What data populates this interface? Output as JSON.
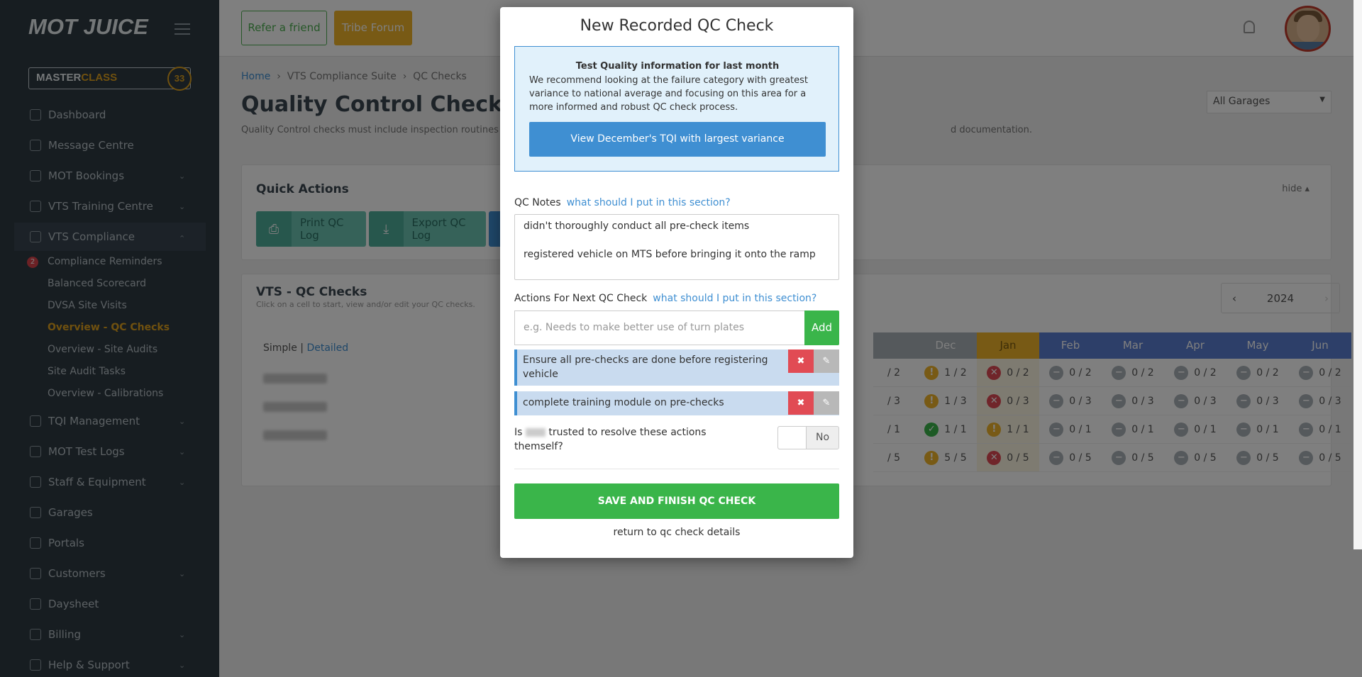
{
  "sidebar": {
    "logo": "MOT JUICE",
    "masterclass": {
      "part1": "MASTER",
      "part2": "CLASS",
      "badge": "33"
    },
    "items": [
      {
        "label": "Dashboard",
        "icon": "home-icon"
      },
      {
        "label": "Message Centre",
        "icon": "chat-icon"
      },
      {
        "label": "MOT Bookings",
        "icon": "bookings-icon"
      },
      {
        "label": "VTS Training Centre",
        "icon": "trophy-icon"
      },
      {
        "label": "VTS Compliance",
        "icon": "check-square-icon"
      },
      {
        "label": "TQI Management",
        "icon": "diamond-icon"
      },
      {
        "label": "MOT Test Logs",
        "icon": "id-card-icon"
      },
      {
        "label": "Staff & Equipment",
        "icon": "user-icon"
      },
      {
        "label": "Garages",
        "icon": "building-icon"
      },
      {
        "label": "Portals",
        "icon": "globe-icon"
      },
      {
        "label": "Customers",
        "icon": "users-icon"
      },
      {
        "label": "Daysheet",
        "icon": "document-icon"
      },
      {
        "label": "Billing",
        "icon": "wallet-icon"
      },
      {
        "label": "Help & Support",
        "icon": "help-icon"
      }
    ],
    "subitems": [
      "Compliance Reminders",
      "Balanced Scorecard",
      "DVSA Site Visits",
      "Overview - QC Checks",
      "Overview - Site Audits",
      "Site Audit Tasks",
      "Overview - Calibrations"
    ],
    "reminder_badge": "2"
  },
  "topbar": {
    "refer": "Refer a friend",
    "tribe": "Tribe Forum"
  },
  "main": {
    "breadcrumb": [
      "Home",
      "VTS Compliance Suite",
      "QC Checks"
    ],
    "title": "Quality Control Checks",
    "desc_start": "Quality Control checks must include inspection routines and",
    "desc_end": "d documentation.",
    "garage_select": "All Garages",
    "quick_actions": {
      "title": "Quick Actions",
      "hide": "hide",
      "print": "Print QC Log",
      "export": "Export QC Log"
    },
    "vts": {
      "title": "VTS - QC Checks",
      "subtitle": "Click on a cell to start, view and/or edit your QC checks.",
      "simple": "Simple",
      "detailed": "Detailed",
      "year": "2024"
    },
    "months": [
      "Dec",
      "Jan",
      "Feb",
      "Mar",
      "Apr",
      "May",
      "Jun"
    ],
    "prev_col": [
      "2",
      "3",
      "1",
      "5"
    ],
    "rows": [
      [
        "1 / 2",
        "0 / 2",
        "0 / 2",
        "0 / 2",
        "0 / 2",
        "0 / 2",
        "0 / 2"
      ],
      [
        "1 / 3",
        "0 / 3",
        "0 / 3",
        "0 / 3",
        "0 / 3",
        "0 / 3",
        "0 / 3"
      ],
      [
        "1 / 1",
        "1 / 1",
        "0 / 1",
        "0 / 1",
        "0 / 1",
        "0 / 1",
        "0 / 1"
      ],
      [
        "5 / 5",
        "0 / 5",
        "0 / 5",
        "0 / 5",
        "0 / 5",
        "0 / 5",
        "0 / 5"
      ]
    ]
  },
  "modal": {
    "title": "New Recorded QC Check",
    "tqi_head": "Test Quality information for last month",
    "tqi_text": "We recommend looking at the failure category with greatest variance to national average and focusing on this area for a more informed and robust QC check process.",
    "tqi_button": "View December's TQI with largest variance",
    "notes_label": "QC Notes",
    "help_link": "what should I put in this section?",
    "notes_line1": "didn't thoroughly conduct all pre-check items",
    "notes_line2": "registered vehicle on MTS before bringing it onto the ramp",
    "actions_label": "Actions For Next QC Check",
    "actions_placeholder": "e.g. Needs to make better use of turn plates",
    "add": "Add",
    "actions": [
      "Ensure all pre-checks are done before registering vehicle",
      "complete training module on pre-checks"
    ],
    "trust_pre": "Is",
    "trust_post": "trusted to resolve these actions themself?",
    "toggle": "No",
    "save": "SAVE AND FINISH QC CHECK",
    "return": "return to qc check details"
  },
  "colors": {
    "green": "#3ab54a",
    "blue": "#3f8fd2",
    "red": "#e14b54",
    "yellow": "#f0b52a",
    "sidebar": "#2f3a42"
  }
}
